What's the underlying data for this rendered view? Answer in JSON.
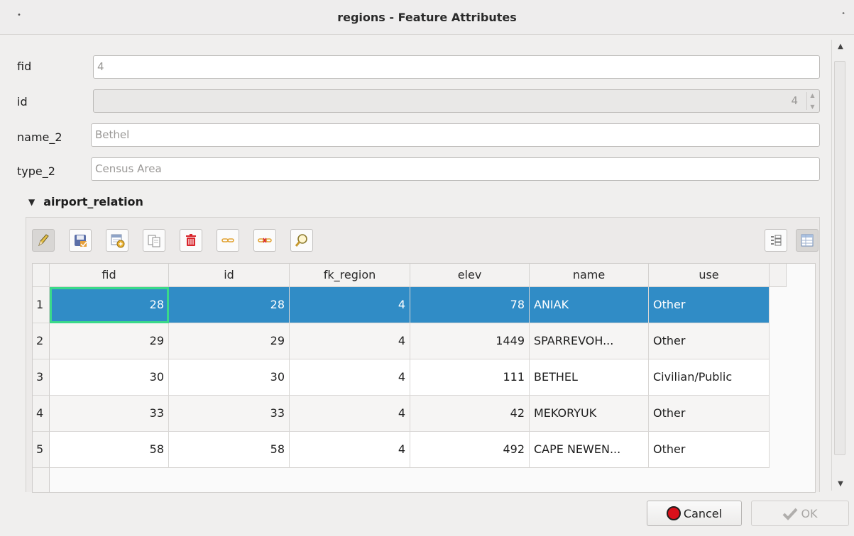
{
  "window": {
    "title": "regions - Feature Attributes"
  },
  "form": {
    "fid": {
      "label": "fid",
      "value": "4"
    },
    "id": {
      "label": "id",
      "value": "4"
    },
    "name_2": {
      "label": "name_2",
      "value": "Bethel"
    },
    "type_2": {
      "label": "type_2",
      "value": "Census Area"
    }
  },
  "relation": {
    "title": "airport_relation",
    "toolbar_icons": [
      "pencil-icon",
      "save-icon",
      "add-feature-icon",
      "duplicate-icon",
      "delete-icon",
      "link-icon",
      "unlink-icon",
      "zoom-icon"
    ],
    "view_icons": [
      "form-view-icon",
      "table-view-icon"
    ],
    "columns": [
      "fid",
      "id",
      "fk_region",
      "elev",
      "name",
      "use"
    ],
    "rows": [
      {
        "num": "1",
        "fid": "28",
        "id": "28",
        "fk_region": "4",
        "elev": "78",
        "name": "ANIAK",
        "use": "Other"
      },
      {
        "num": "2",
        "fid": "29",
        "id": "29",
        "fk_region": "4",
        "elev": "1449",
        "name": "SPARREVOH...",
        "use": "Other"
      },
      {
        "num": "3",
        "fid": "30",
        "id": "30",
        "fk_region": "4",
        "elev": "111",
        "name": "BETHEL",
        "use": "Civilian/Public"
      },
      {
        "num": "4",
        "fid": "33",
        "id": "33",
        "fk_region": "4",
        "elev": "42",
        "name": "MEKORYUK",
        "use": "Other"
      },
      {
        "num": "5",
        "fid": "58",
        "id": "58",
        "fk_region": "4",
        "elev": "492",
        "name": "CAPE NEWEN...",
        "use": "Other"
      }
    ],
    "selected_row": 1
  },
  "buttons": {
    "cancel": "Cancel",
    "ok": "OK"
  },
  "colors": {
    "selection": "#308cc6",
    "current_cell": "#3ad98a",
    "cancel_icon": "#d8101a"
  }
}
